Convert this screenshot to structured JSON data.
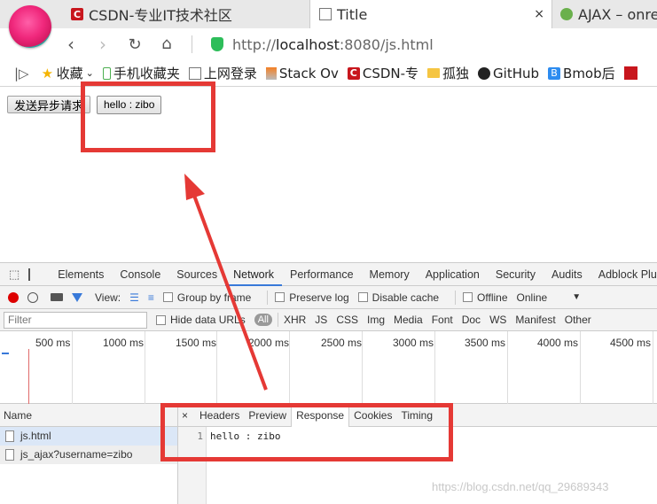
{
  "browser": {
    "tabs": [
      {
        "title": "CSDN-专业IT技术社区",
        "favicon": "csdn-logo-icon"
      },
      {
        "title": "Title",
        "favicon": "document-icon",
        "active": true
      },
      {
        "title": "AJAX – onre",
        "favicon": "green-globe-icon"
      }
    ],
    "tab_close": "×",
    "url_prefix": "http://",
    "url_host": "localhost",
    "url_rest": ":8080/js.html",
    "bookmarks": [
      "收藏",
      "手机收藏夹",
      "上网登录",
      "Stack Ov",
      "CSDN-专",
      "孤独",
      "GitHub",
      "Bmob后"
    ]
  },
  "page": {
    "send_button": "发送异步请求",
    "response_text": "hello : zibo"
  },
  "devtools": {
    "tabs": [
      "Elements",
      "Console",
      "Sources",
      "Network",
      "Performance",
      "Memory",
      "Application",
      "Security",
      "Audits",
      "Adblock Plus"
    ],
    "active_tab": "Network",
    "toolbar": {
      "view_label": "View:",
      "group_by_frame": "Group by frame",
      "preserve_log": "Preserve log",
      "disable_cache": "Disable cache",
      "offline": "Offline",
      "throttle": "Online"
    },
    "filter": {
      "placeholder": "Filter",
      "hide_data_urls": "Hide data URLs",
      "all": "All",
      "types": [
        "XHR",
        "JS",
        "CSS",
        "Img",
        "Media",
        "Font",
        "Doc",
        "WS",
        "Manifest",
        "Other"
      ]
    },
    "timeline_ticks": [
      "500 ms",
      "1000 ms",
      "1500 ms",
      "2000 ms",
      "2500 ms",
      "3000 ms",
      "3500 ms",
      "4000 ms",
      "4500 ms"
    ],
    "requests_header": "Name",
    "requests": [
      "js.html",
      "js_ajax?username=zibo"
    ],
    "detail_close": "×",
    "detail_tabs": [
      "Headers",
      "Preview",
      "Response",
      "Cookies",
      "Timing"
    ],
    "detail_active": "Response",
    "response_line_number": "1",
    "response_body": "hello : zibo"
  },
  "watermark": "https://blog.csdn.net/qq_29689343",
  "colors": {
    "annotation": "#e53935",
    "accent": "#3879d9"
  }
}
